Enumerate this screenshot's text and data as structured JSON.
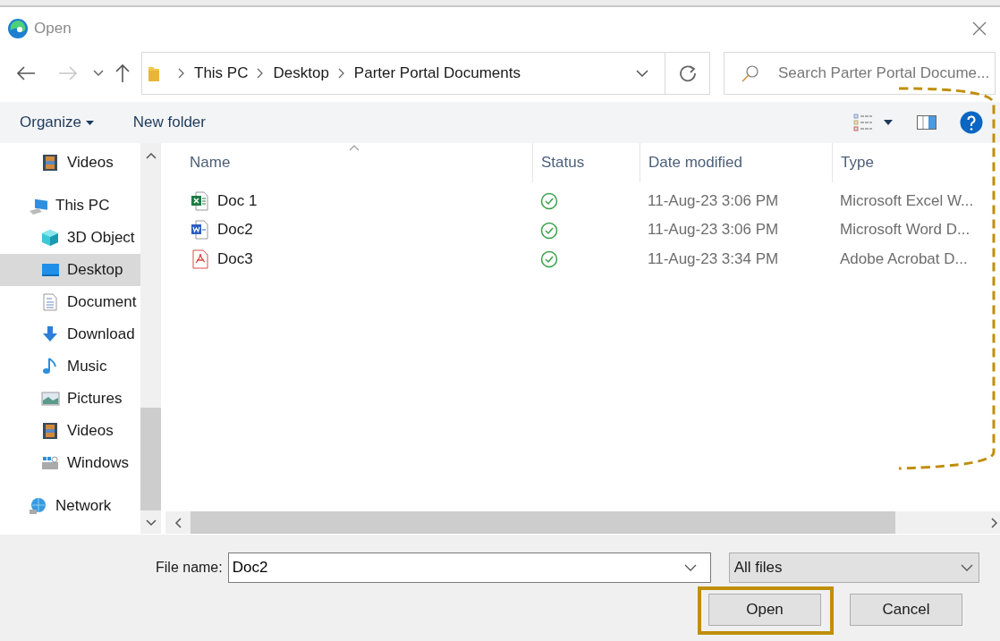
{
  "window": {
    "title": "Open"
  },
  "address": {
    "crumbs": [
      "This PC",
      "Desktop",
      "Parter Portal Documents"
    ]
  },
  "search": {
    "placeholder": "Search Parter Portal Docume..."
  },
  "toolbar": {
    "buttons": [
      "Organize",
      "New folder"
    ]
  },
  "sidebar": {
    "items": [
      {
        "label": "Videos",
        "kind": "videos",
        "selected": false
      },
      {
        "label": "This PC",
        "kind": "pc",
        "selected": false,
        "children": [
          {
            "label": "3D Object",
            "kind": "cube",
            "selected": false
          },
          {
            "label": "Desktop",
            "kind": "desktop",
            "selected": true
          },
          {
            "label": "Document",
            "kind": "document",
            "selected": false
          },
          {
            "label": "Download",
            "kind": "download",
            "selected": false
          },
          {
            "label": "Music",
            "kind": "music",
            "selected": false
          },
          {
            "label": "Pictures",
            "kind": "pictures",
            "selected": false
          },
          {
            "label": "Videos",
            "kind": "videos",
            "selected": false
          },
          {
            "label": "Windows",
            "kind": "drive",
            "selected": false
          }
        ]
      },
      {
        "label": "Network",
        "kind": "network",
        "selected": false
      }
    ]
  },
  "table": {
    "columns": [
      {
        "label": "Name",
        "sorted": true
      },
      {
        "label": "Status",
        "sorted": false
      },
      {
        "label": "Date modified",
        "sorted": false
      },
      {
        "label": "Type",
        "sorted": false
      }
    ],
    "rows": [
      {
        "name": "Doc 1",
        "kind": "excel",
        "synced": true,
        "date": "11-Aug-23 3:06 PM",
        "type": "Microsoft Excel W..."
      },
      {
        "name": "Doc2",
        "kind": "word",
        "synced": true,
        "date": "11-Aug-23 3:06 PM",
        "type": "Microsoft Word D..."
      },
      {
        "name": "Doc3",
        "kind": "pdf",
        "synced": true,
        "date": "11-Aug-23 3:34 PM",
        "type": "Adobe Acrobat D..."
      }
    ]
  },
  "file_name": {
    "label": "File name:",
    "value": "Doc2"
  },
  "file_type": {
    "value": "All files"
  },
  "buttons": [
    {
      "label": "Open",
      "highlighted": true
    },
    {
      "label": "Cancel",
      "highlighted": false
    }
  ]
}
